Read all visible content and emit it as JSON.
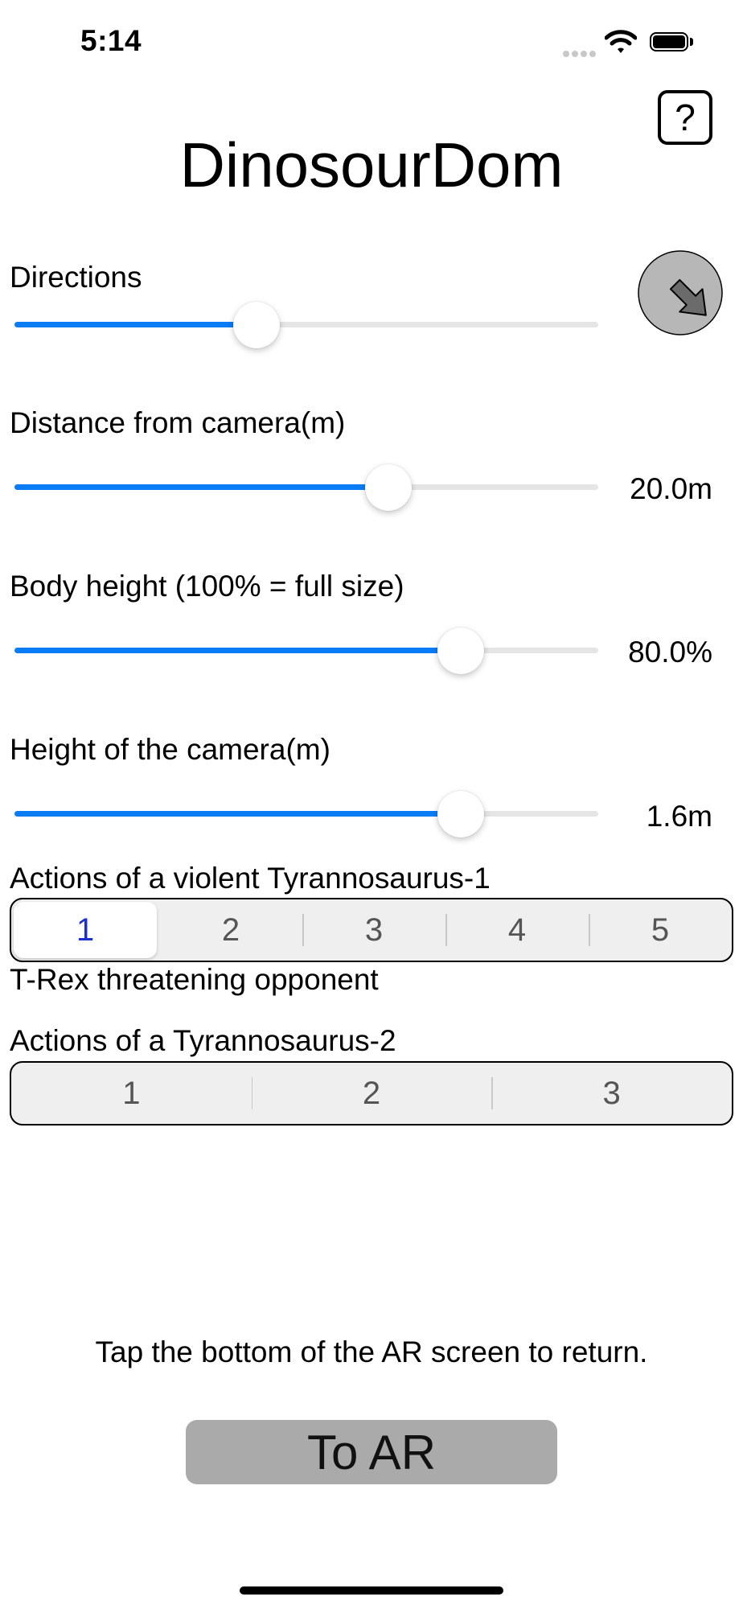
{
  "status_bar": {
    "time": "5:14"
  },
  "header": {
    "title": "DinosourDom",
    "help_label": "?"
  },
  "sliders": {
    "directions": {
      "label": "Directions",
      "fraction": 0.415
    },
    "distance": {
      "label": "Distance from camera(m)",
      "value": "20.0m",
      "fraction": 0.64
    },
    "body_height": {
      "label": "Body height (100% = full size)",
      "value": "80.0%",
      "fraction": 0.765
    },
    "camera_height": {
      "label": "Height of the camera(m)",
      "value": "1.6m",
      "fraction": 0.765
    }
  },
  "actions1": {
    "label": "Actions of a violent Tyrannosaurus-1",
    "segments": [
      "1",
      "2",
      "3",
      "4",
      "5"
    ],
    "selected_index": 0,
    "caption": "T-Rex threatening opponent"
  },
  "actions2": {
    "label": "Actions of a Tyrannosaurus-2",
    "segments": [
      "1",
      "2",
      "3"
    ],
    "selected_index": -1
  },
  "footer": {
    "hint": "Tap the bottom of the AR screen to return.",
    "ar_button_label": "To AR"
  },
  "colors": {
    "accent": "#0a7cf6",
    "selected_segment_text": "#1a2fd0",
    "ar_button_bg": "#aaaaaa"
  },
  "icons": {
    "help": "question-mark-icon",
    "direction": "arrow-down-right-icon"
  }
}
